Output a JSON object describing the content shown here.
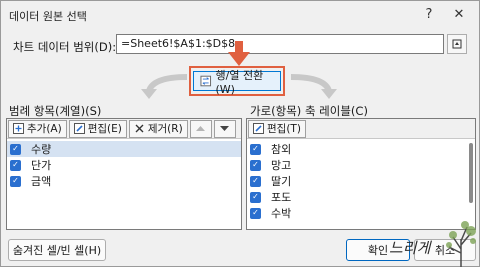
{
  "window": {
    "title": "데이터 원본 선택",
    "help_icon": "?",
    "close_icon": "✕"
  },
  "range": {
    "label": "차트 데이터 범위(D):",
    "value": "=Sheet6!$A$1:$D$8"
  },
  "switch": {
    "label": "행/열 전환(W)"
  },
  "legend": {
    "label": "범례 항목(계열)(S)",
    "add": "추가(A)",
    "edit": "편집(E)",
    "remove": "제거(R)",
    "items": [
      {
        "label": "수량",
        "checked": true,
        "selected": true
      },
      {
        "label": "단가",
        "checked": true,
        "selected": false
      },
      {
        "label": "금액",
        "checked": true,
        "selected": false
      }
    ]
  },
  "axis": {
    "label": "가로(항목) 축 레이블(C)",
    "edit": "편집(T)",
    "items": [
      {
        "label": "참외",
        "checked": true
      },
      {
        "label": "망고",
        "checked": true
      },
      {
        "label": "딸기",
        "checked": true
      },
      {
        "label": "포도",
        "checked": true
      },
      {
        "label": "수박",
        "checked": true
      }
    ]
  },
  "buttons": {
    "hidden_cells": "숨겨진 셀/빈 셀(H)",
    "ok": "확인",
    "cancel": "취소"
  },
  "watermark": {
    "text": "느리게"
  },
  "colors": {
    "accent": "#2a6fcf",
    "highlight": "#e06040"
  }
}
